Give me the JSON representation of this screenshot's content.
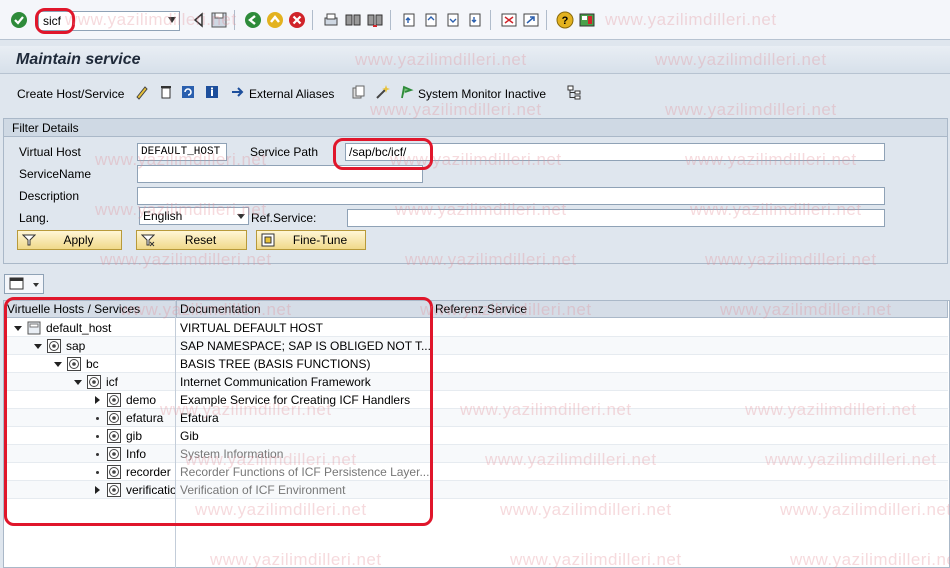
{
  "command_field": {
    "value": "sicf"
  },
  "title": "Maintain service",
  "app_toolbar": {
    "create_host_service": "Create Host/Service",
    "external_aliases": "External Aliases",
    "system_monitor_inactive": "System Monitor Inactive"
  },
  "filter": {
    "header": "Filter Details",
    "virtual_host_label": "Virtual Host",
    "virtual_host_value": "DEFAULT_HOST",
    "service_path_label": "Service Path",
    "service_path_value": "/sap/bc/icf/",
    "service_name_label": "ServiceName",
    "service_name_value": "",
    "description_label": "Description",
    "description_value": "",
    "lang_label": "Lang.",
    "lang_value": "English",
    "ref_service_label": "Ref.Service:",
    "ref_service_value": "",
    "apply_label": "Apply",
    "reset_label": "Reset",
    "fine_tune_label": "Fine-Tune"
  },
  "tree": {
    "columns": [
      "Virtuelle Hosts / Services",
      "Documentation",
      "Referenz Service"
    ],
    "rows": [
      {
        "name": "default_host",
        "doc": "VIRTUAL DEFAULT HOST",
        "icon": "host-icon",
        "level": 0,
        "expanded": true
      },
      {
        "name": "sap",
        "doc": "SAP NAMESPACE; SAP IS OBLIGED NOT T...",
        "icon": "service-node-icon",
        "level": 1,
        "expanded": true
      },
      {
        "name": "bc",
        "doc": "BASIS TREE (BASIS FUNCTIONS)",
        "icon": "service-node-icon",
        "level": 2,
        "expanded": true
      },
      {
        "name": "icf",
        "doc": "Internet Communication Framework",
        "icon": "service-node-icon",
        "level": 3,
        "expanded": true
      },
      {
        "name": "demo",
        "doc": "Example Service for Creating ICF Handlers",
        "icon": "service-node-icon",
        "level": 4,
        "expander": "right",
        "inactive": false
      },
      {
        "name": "efatura",
        "doc": "Efatura",
        "icon": "service-node-icon",
        "level": 4,
        "expander": "dot",
        "inactive": false
      },
      {
        "name": "gib",
        "doc": "Gib",
        "icon": "service-node-icon",
        "level": 4,
        "expander": "dot",
        "inactive": false
      },
      {
        "name": "Info",
        "doc": "System Information",
        "icon": "service-node-icon",
        "level": 4,
        "expander": "dot",
        "inactive": true
      },
      {
        "name": "recorder",
        "doc": "Recorder Functions of ICF Persistence Layer...",
        "icon": "service-node-icon",
        "level": 4,
        "expander": "dot",
        "inactive": true
      },
      {
        "name": "verificatio",
        "doc": "Verification of ICF Environment",
        "icon": "service-node-icon",
        "level": 4,
        "expander": "right",
        "inactive": true
      }
    ]
  },
  "watermark": "www.yazilimdilleri.net",
  "colors": {
    "highlight": "#e0162b",
    "button_fill": "#f0d98a",
    "title_text": "#1f2a3a"
  }
}
